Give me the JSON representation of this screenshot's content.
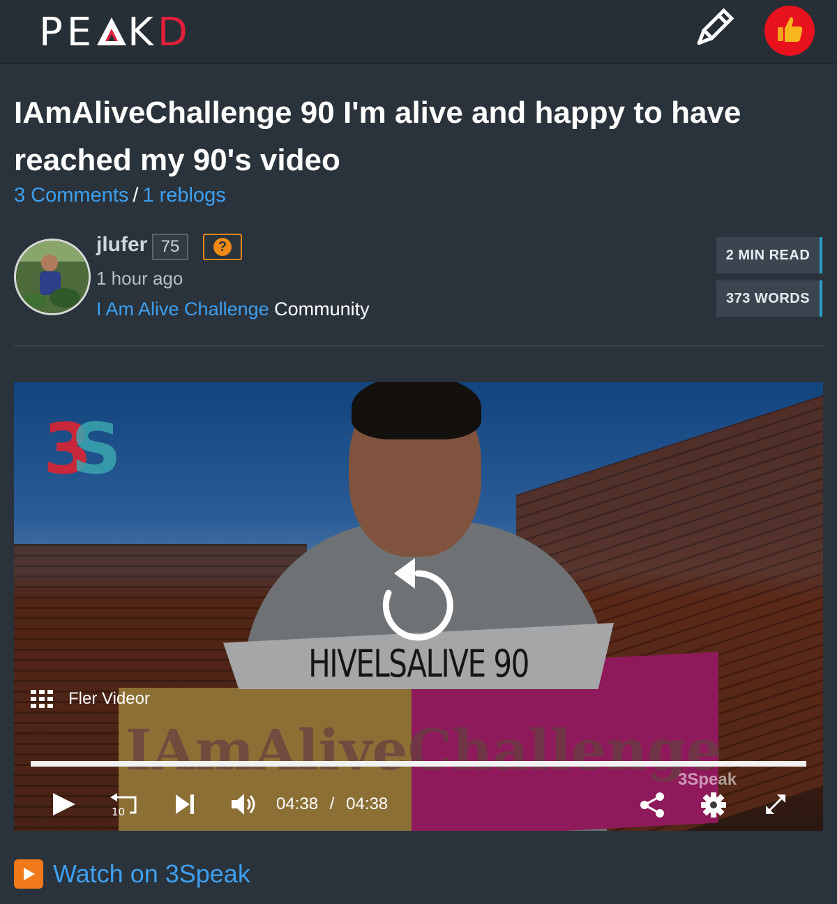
{
  "header": {
    "logo_text_1": "PE",
    "logo_text_2": "K",
    "logo_text_3": "D",
    "brand_red": "#e0203a",
    "edit_icon": "pencil-icon",
    "upvote_icon": "thumbs-up-icon"
  },
  "post": {
    "title": "IAmAliveChallenge 90 I'm alive and happy to have reached my 90's video",
    "comments_label": "3 Comments",
    "separator": "/",
    "reblogs_label": "1 reblogs",
    "author": "jlufer",
    "reputation": "75",
    "help_label": "?",
    "posted_time": "1 hour ago",
    "community_link": "I Am Alive Challenge",
    "community_suffix": "Community",
    "read_time": "2 MIN READ",
    "word_count": "373 WORDS"
  },
  "video": {
    "overlay_title": "HIVELSALIVE 90",
    "band_text": "IAmAliveChallenge",
    "more_videos_label": "Fler Videor",
    "watermark": "3Speak",
    "progress": 1.0,
    "current_time": "04:38",
    "time_separator": "/",
    "duration": "04:38",
    "controls": [
      "play-icon",
      "rewind-10-icon",
      "next-icon",
      "volume-icon",
      "share-icon",
      "settings-icon",
      "fullscreen-icon"
    ]
  },
  "footer": {
    "watch_label": "Watch on 3Speak",
    "watch_icon": "play-button-icon"
  }
}
